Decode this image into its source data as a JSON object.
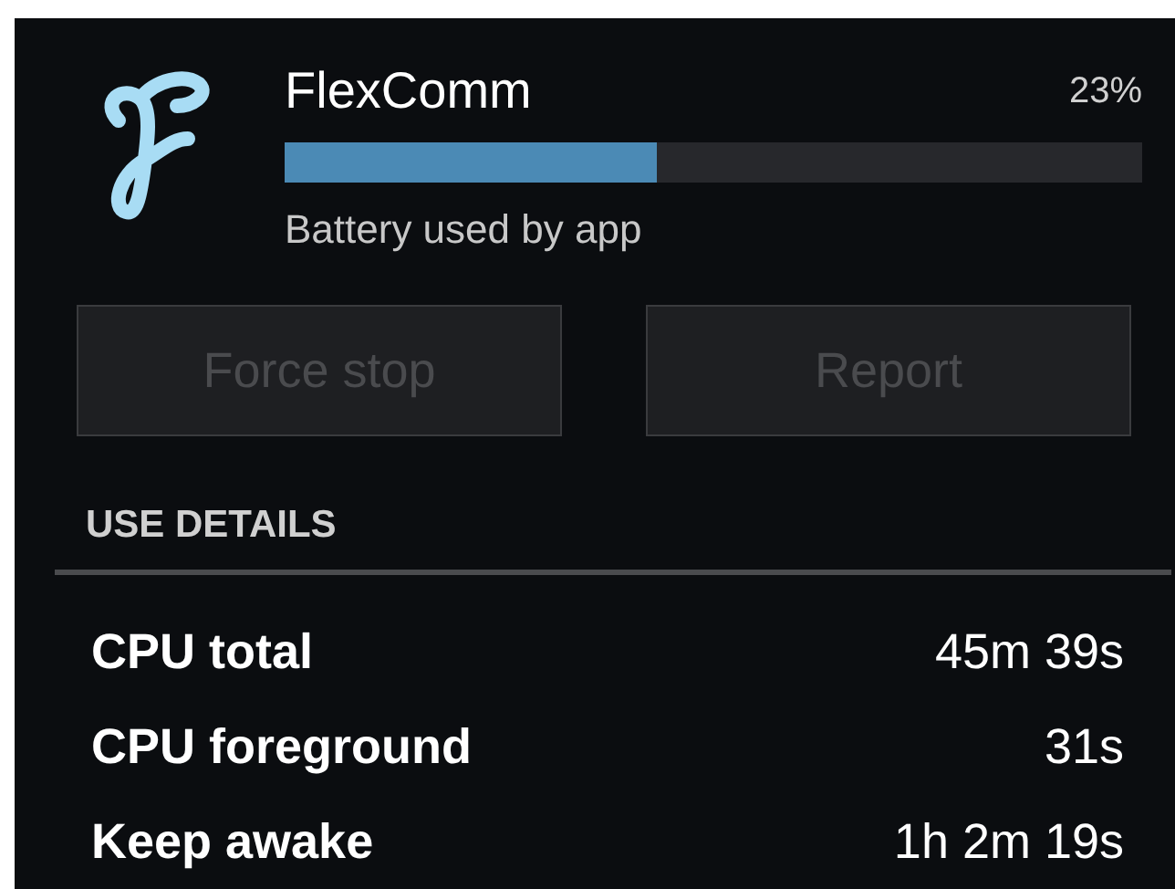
{
  "app": {
    "name": "FlexComm",
    "percent": "23%",
    "level": 0.434,
    "caption": "Battery used by app"
  },
  "buttons": [
    {
      "label": "Force stop",
      "disabled": true
    },
    {
      "label": "Report",
      "disabled": true
    }
  ],
  "section": "USE DETAILS",
  "details": [
    {
      "label": "CPU total",
      "value": "45m 39s"
    },
    {
      "label": "CPU foreground",
      "value": "31s"
    },
    {
      "label": "Keep awake",
      "value": "1h 2m 19s"
    }
  ]
}
